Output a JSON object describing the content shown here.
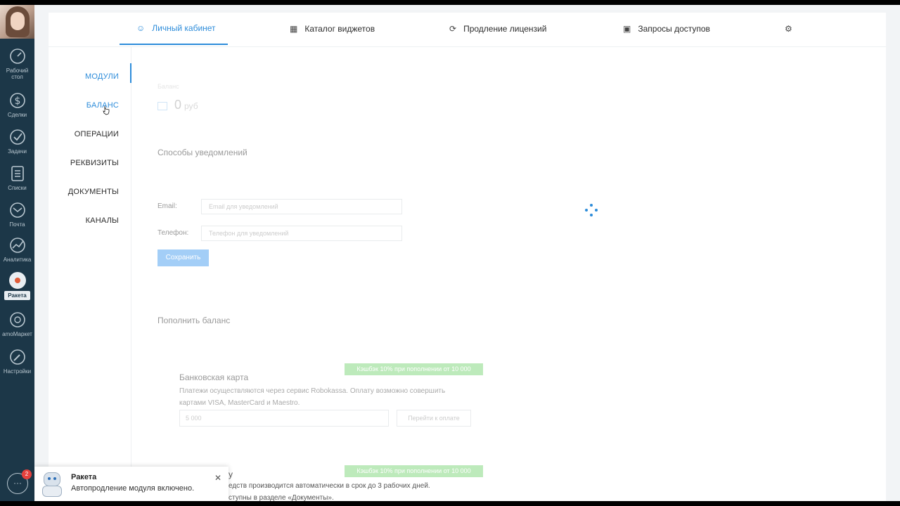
{
  "sidebar": {
    "items": [
      {
        "label": "Рабочий стол",
        "icon": "dashboard-icon"
      },
      {
        "label": "Сделки",
        "icon": "dollar-icon"
      },
      {
        "label": "Задачи",
        "icon": "check-icon"
      },
      {
        "label": "Списки",
        "icon": "list-icon"
      },
      {
        "label": "Почта",
        "icon": "mail-icon"
      },
      {
        "label": "Аналитика",
        "icon": "analytics-icon"
      },
      {
        "label": "Ракета",
        "icon": "rocket-icon"
      },
      {
        "label": "amoМаркет",
        "icon": "market-icon"
      },
      {
        "label": "Настройки",
        "icon": "wrench-icon"
      }
    ],
    "chat_badge": "2"
  },
  "tabs": [
    {
      "label": "Личный кабинет",
      "icon": "user-icon"
    },
    {
      "label": "Каталог виджетов",
      "icon": "grid-icon"
    },
    {
      "label": "Продление лицензий",
      "icon": "refresh-icon"
    },
    {
      "label": "Запросы доступов",
      "icon": "lock-icon"
    }
  ],
  "subnav": [
    "МОДУЛИ",
    "БАЛАНС",
    "ОПЕРАЦИИ",
    "РЕКВИЗИТЫ",
    "ДОКУМЕНТЫ",
    "КАНАЛЫ"
  ],
  "balance": {
    "label": "Баланс",
    "value": "0",
    "currency": "руб"
  },
  "notifications": {
    "title": "Способы уведомлений",
    "email_label": "Email:",
    "email_placeholder": "Email для уведомлений",
    "phone_label": "Телефон:",
    "phone_placeholder": "Телефон для уведомлений",
    "save": "Сохранить"
  },
  "topup": {
    "title": "Пополнить баланс",
    "card": {
      "promo": "Кэшбэк 10% при пополнении от 10 000",
      "title": "Банковская карта",
      "desc": "Платежи осуществляются через сервис Robokassa. Оплату возможно совершить картами VISA, MasterCard и Maestro.",
      "amount_placeholder": "5 000",
      "button": "Перейти к оплате"
    },
    "invoice": {
      "promo": "Кэшбэк 10% при пополнении от 10 000",
      "title_partial": "у",
      "line1": "едств производится автоматически в срок до 3 рабочих дней.",
      "line2": "ступны в разделе «Документы»."
    }
  },
  "toast": {
    "title": "Ракета",
    "text": "Автопродление модуля включено."
  },
  "colors": {
    "accent": "#2d8cda",
    "sidebar": "#1c3748",
    "promo": "#7ed67a"
  }
}
